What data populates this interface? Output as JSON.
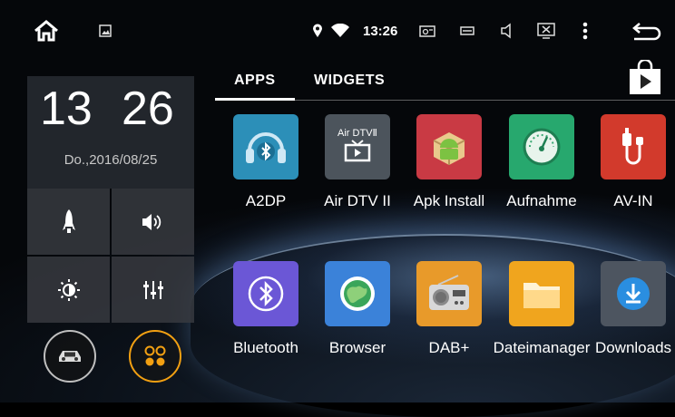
{
  "status": {
    "time": "13:26",
    "icons": [
      "home-icon",
      "gallery-icon",
      "location-icon",
      "wifi-icon",
      "radio-icon",
      "usb-icon",
      "volume-icon",
      "screen-icon",
      "overflow-menu-icon",
      "back-icon"
    ]
  },
  "widget": {
    "hour": "13",
    "minute": "26",
    "date": "Do.,2016/08/25",
    "quick_buttons": [
      "rocket-icon",
      "volume-icon",
      "brightness-icon",
      "equalizer-icon"
    ]
  },
  "tabs": {
    "apps": "APPS",
    "widgets": "WIDGETS",
    "active": "apps"
  },
  "apps": [
    {
      "label": "A2DP",
      "icon": "bluetooth-headphones-icon",
      "color": "#2c8fb8"
    },
    {
      "label": "Air DTV II",
      "icon": "tv-icon",
      "tile_text": "Air DTVⅡ",
      "color": "#4c545c"
    },
    {
      "label": "Apk Install",
      "icon": "android-package-icon",
      "color": "#c93a44"
    },
    {
      "label": "Aufnahme",
      "icon": "recorder-gauge-icon",
      "color": "#27a86e"
    },
    {
      "label": "AV-IN",
      "icon": "av-cable-icon",
      "color": "#d23a2c"
    },
    {
      "label": "Bluetooth",
      "icon": "bluetooth-icon",
      "color": "#6b57d6"
    },
    {
      "label": "Browser",
      "icon": "globe-icon",
      "color": "#3b82d9"
    },
    {
      "label": "DAB+",
      "icon": "radio-icon",
      "color": "#e89a2a"
    },
    {
      "label": "Dateimanager",
      "icon": "folder-icon",
      "color": "#f0a51e"
    },
    {
      "label": "Downloads",
      "icon": "download-icon",
      "color": "#4d5560"
    }
  ],
  "colors": {
    "accent": "#f2a012",
    "panel": "#2c3036"
  }
}
